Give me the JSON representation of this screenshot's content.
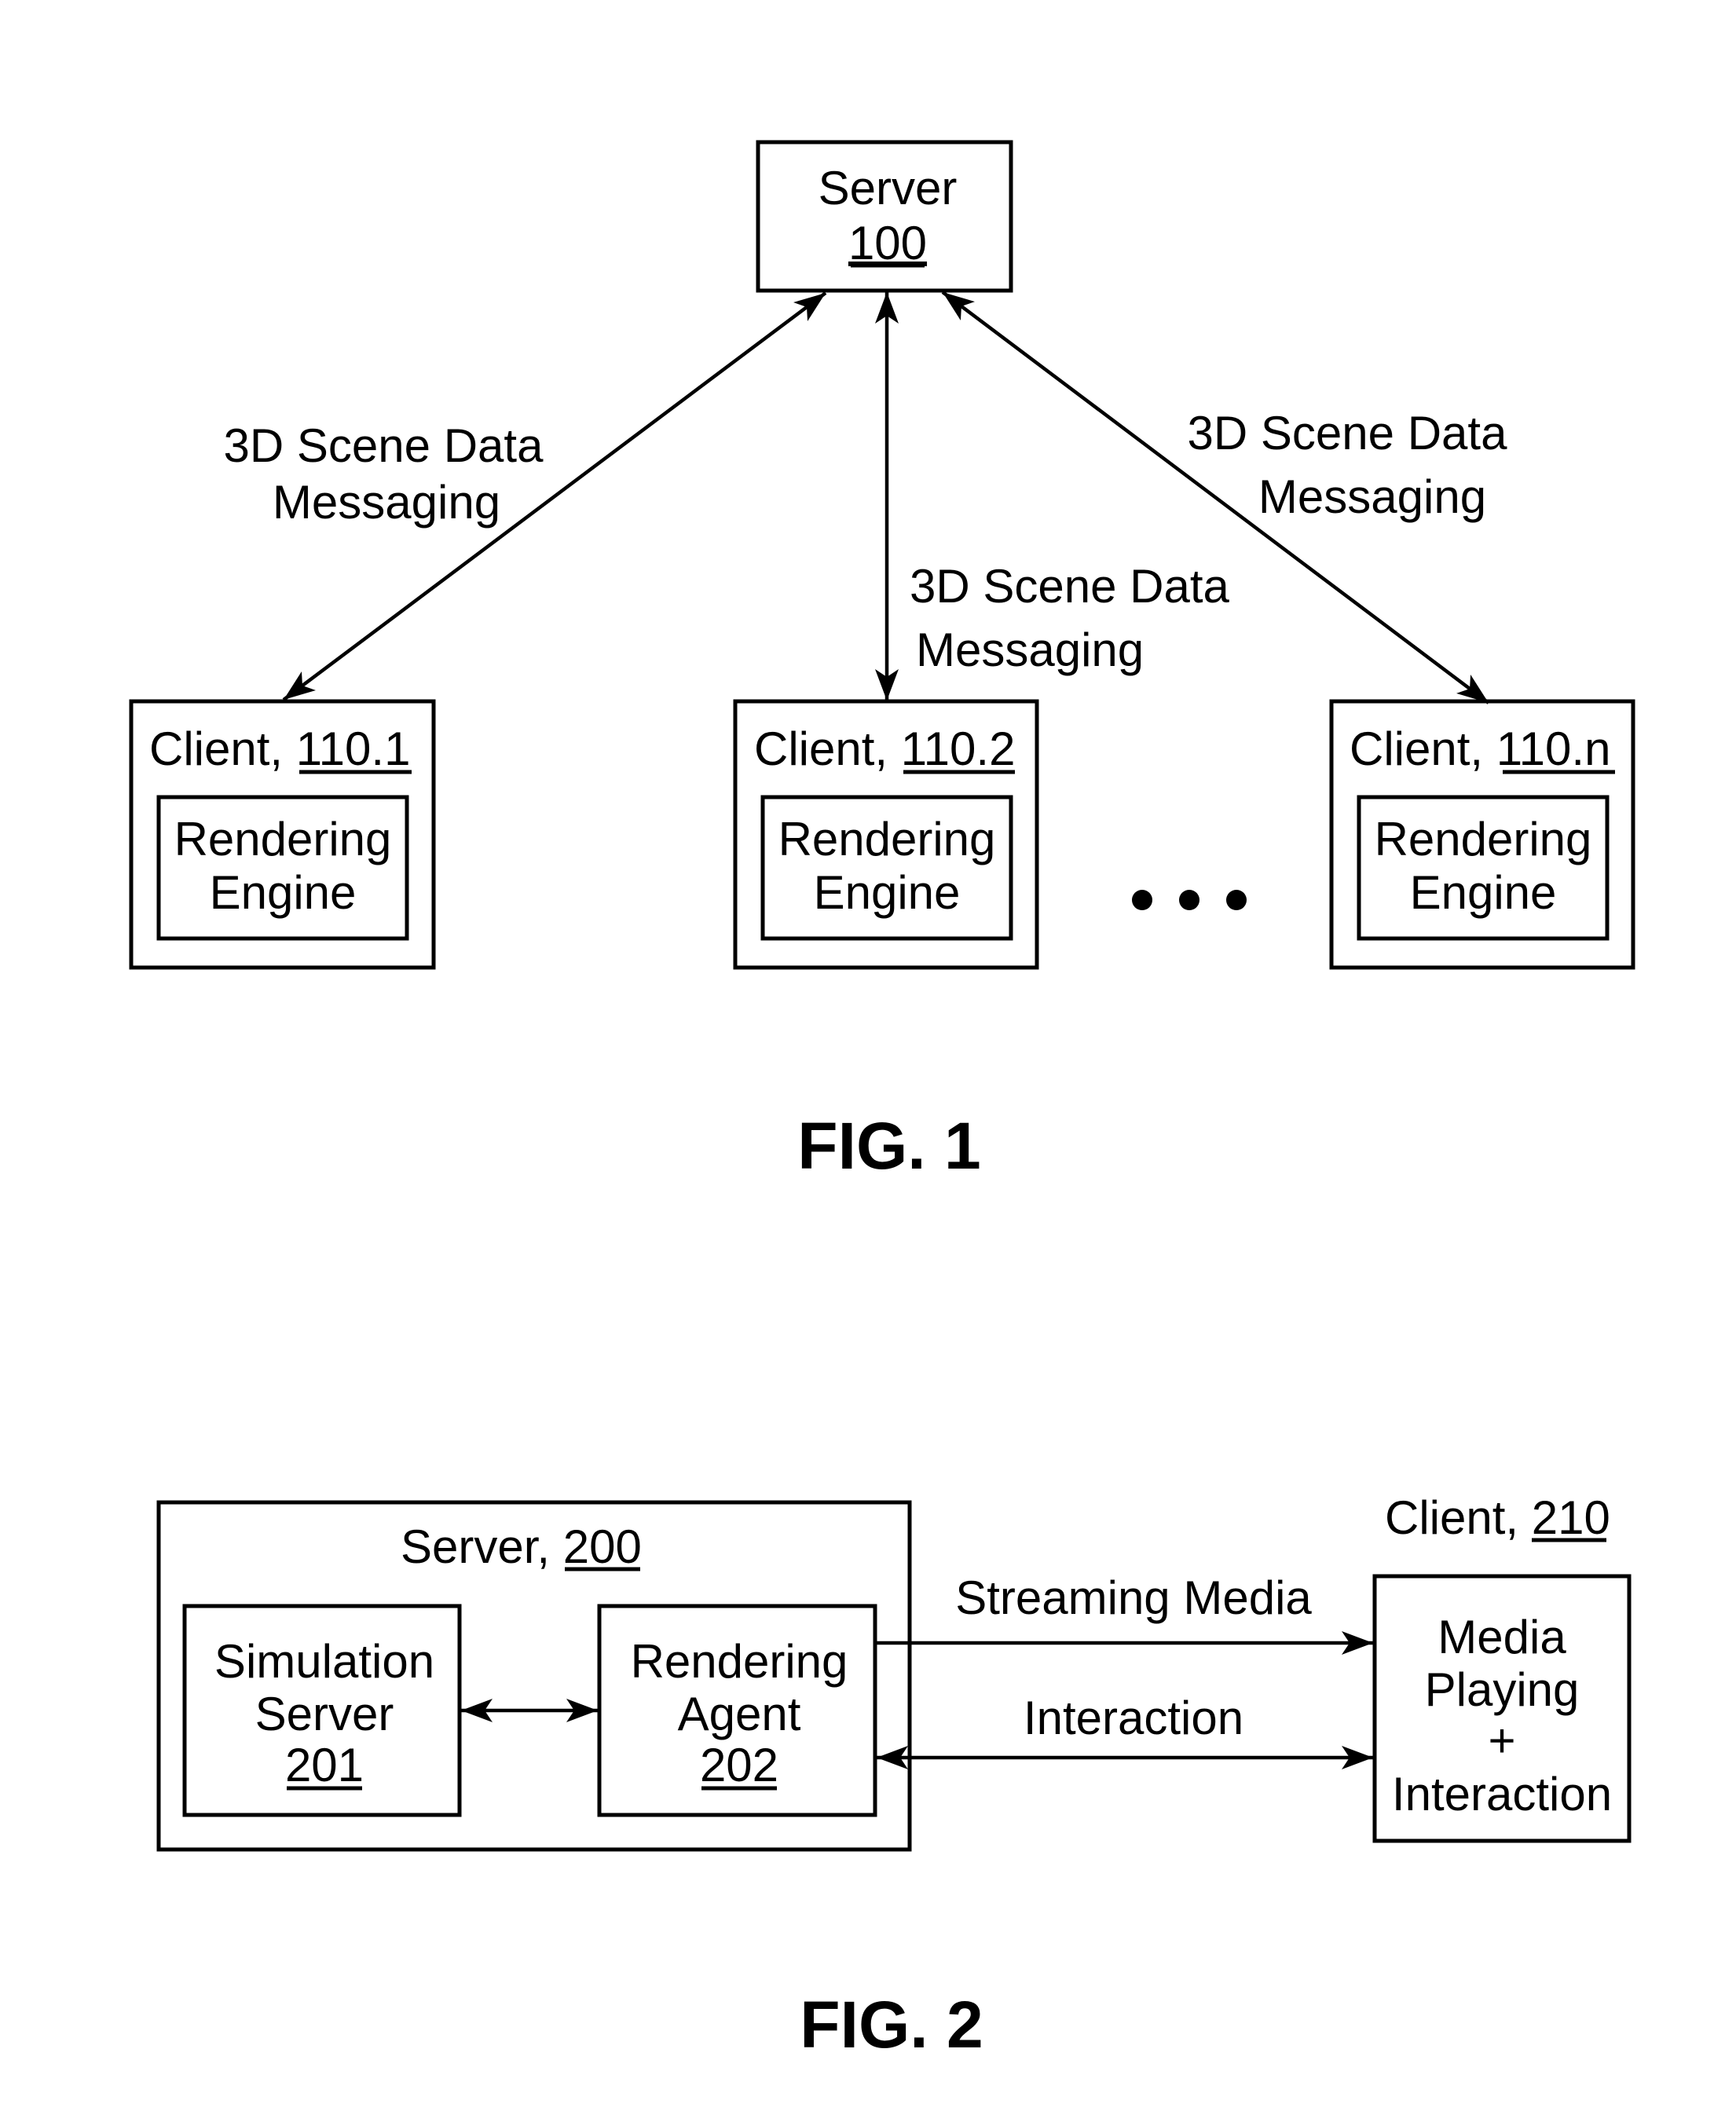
{
  "fig1": {
    "caption": "FIG. 1",
    "server": {
      "label": "Server",
      "ref": "100"
    },
    "clients": [
      {
        "label": "Client, ",
        "ref": "110.1",
        "engine_line1": "Rendering",
        "engine_line2": "Engine"
      },
      {
        "label": "Client, ",
        "ref": "110.2",
        "engine_line1": "Rendering",
        "engine_line2": "Engine"
      },
      {
        "label": "Client, ",
        "ref": "110.n",
        "engine_line1": "Rendering",
        "engine_line2": "Engine"
      }
    ],
    "ellipsis": "• • •",
    "links": [
      {
        "line1": "3D Scene Data",
        "line2": "Messaging",
        "direction": "bidirectional"
      },
      {
        "line1": "3D Scene Data",
        "line2": "Messaging",
        "direction": "bidirectional"
      },
      {
        "line1": "3D Scene Data",
        "line2": "Messaging",
        "direction": "bidirectional"
      }
    ]
  },
  "fig2": {
    "caption": "FIG. 2",
    "server": {
      "label": "Server, ",
      "ref": "200"
    },
    "simulation_server": {
      "line1": "Simulation",
      "line2": "Server",
      "ref": "201"
    },
    "rendering_agent": {
      "line1": "Rendering",
      "line2": "Agent",
      "ref": "202"
    },
    "client": {
      "label": "Client, ",
      "ref": "210",
      "line1": "Media",
      "line2": "Playing",
      "line3": "+",
      "line4": "Interaction"
    },
    "links": {
      "streaming": {
        "label": "Streaming Media",
        "direction": "server-to-client"
      },
      "interaction": {
        "label": "Interaction",
        "direction": "bidirectional"
      },
      "internal": {
        "direction": "bidirectional"
      }
    }
  }
}
